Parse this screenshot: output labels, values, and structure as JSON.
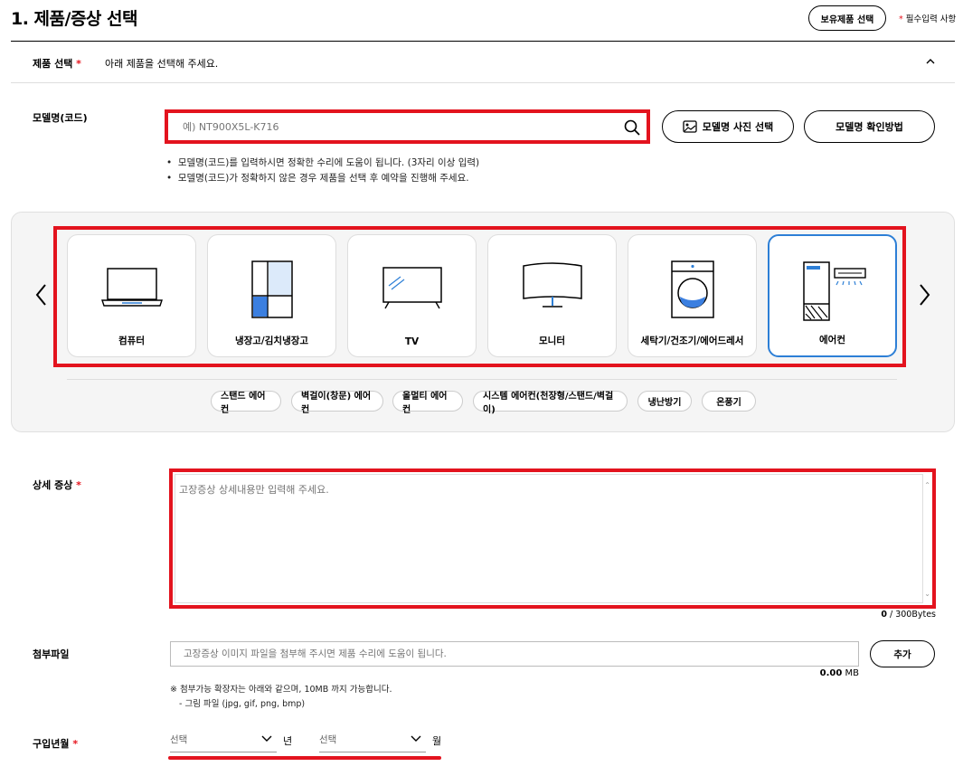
{
  "header": {
    "title": "1. 제품/증상 선택",
    "owned_products_button": "보유제품 선택",
    "required_note_star": "*",
    "required_note": "필수입력 사항"
  },
  "product_select": {
    "label": "제품 선택",
    "star": "*",
    "hint": "아래 제품을 선택해 주세요."
  },
  "model": {
    "label": "모델명(코드)",
    "placeholder": "예) NT900X5L-K716",
    "photo_button": "모델명 사진 선택",
    "howto_button": "모델명 확인방법",
    "notes": [
      "모델명(코드)를 입력하시면 정확한 수리에 도움이 됩니다. (3자리 이상 입력)",
      "모델명(코드)가 정확하지 않은 경우 제품을 선택 후 예약을 진행해 주세요."
    ]
  },
  "categories": [
    {
      "label": "컴퓨터",
      "icon": "laptop-icon"
    },
    {
      "label": "냉장고/김치냉장고",
      "icon": "refrigerator-icon"
    },
    {
      "label": "TV",
      "icon": "tv-icon"
    },
    {
      "label": "모니터",
      "icon": "monitor-icon"
    },
    {
      "label": "세탁기/건조기/에어드레서",
      "icon": "washer-icon"
    },
    {
      "label": "에어컨",
      "icon": "air-conditioner-icon",
      "selected": true
    }
  ],
  "subcategories": [
    "스탠드 에어컨",
    "벽걸이(창문) 에어컨",
    "올멀티 에어컨",
    "시스템 에어컨(천장형/스탠드/벽걸이)",
    "냉난방기",
    "온풍기"
  ],
  "symptom": {
    "label": "상세 증상",
    "star": "*",
    "placeholder": "고장증상 상세내용만 입력해 주세요.",
    "counter_value": "0",
    "counter_unit": " / 300Bytes"
  },
  "attachment": {
    "label": "첨부파일",
    "placeholder": "고장증상 이미지 파일을 첨부해 주시면 제품 수리에 도움이 됩니다.",
    "add_button": "추가",
    "size_value": "0.00",
    "size_unit": " MB",
    "note1": "※ 첨부가능 확장자는 아래와 같으며, 10MB 까지 가능합니다.",
    "note2": "- 그림 파일 (jpg, gif, png, bmp)"
  },
  "purchase": {
    "label": "구입년월",
    "star": "*",
    "year_placeholder": "선택",
    "year_unit": "년",
    "month_placeholder": "선택",
    "month_unit": "월"
  },
  "colors": {
    "highlight_red": "#e3131e",
    "selected_blue": "#2d7fd6",
    "required_red": "#e6141e"
  }
}
